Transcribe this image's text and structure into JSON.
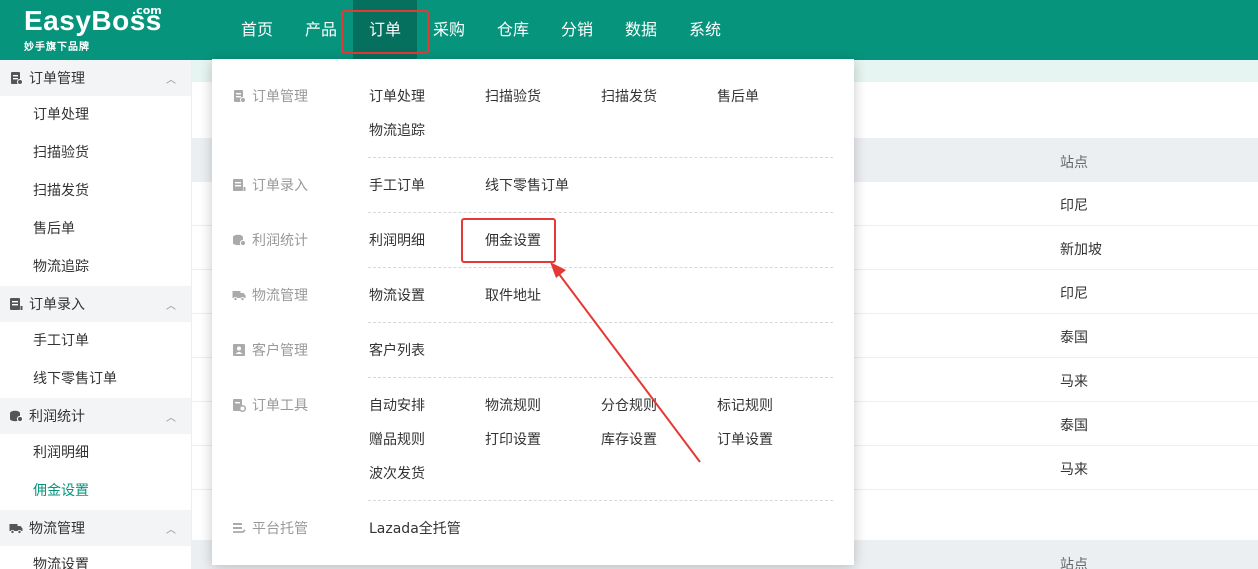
{
  "logo": {
    "main": "EasyBoss",
    "com": ".com",
    "sub": "妙手旗下品牌"
  },
  "nav": [
    "首页",
    "产品",
    "订单",
    "采购",
    "仓库",
    "分销",
    "数据",
    "系统"
  ],
  "sidebar": {
    "groups": [
      {
        "label": "订单管理",
        "icon": "order-manage-icon",
        "items": [
          "订单处理",
          "扫描验货",
          "扫描发货",
          "售后单",
          "物流追踪"
        ]
      },
      {
        "label": "订单录入",
        "icon": "order-entry-icon",
        "items": [
          "手工订单",
          "线下零售订单"
        ]
      },
      {
        "label": "利润统计",
        "icon": "profit-icon",
        "items": [
          "利润明细",
          "佣金设置"
        ]
      },
      {
        "label": "物流管理",
        "icon": "truck-icon",
        "items": [
          "物流设置"
        ]
      }
    ],
    "active_item": "佣金设置"
  },
  "table": {
    "site_header": "站点",
    "sites": [
      "印尼",
      "新加坡",
      "印尼",
      "泰国",
      "马来",
      "泰国",
      "马来"
    ]
  },
  "dropdown": {
    "sections": [
      {
        "title": "订单管理",
        "links": [
          "订单处理",
          "扫描验货",
          "扫描发货",
          "售后单",
          "物流追踪"
        ]
      },
      {
        "title": "订单录入",
        "links": [
          "手工订单",
          "线下零售订单"
        ]
      },
      {
        "title": "利润统计",
        "links": [
          "利润明细",
          "佣金设置"
        ]
      },
      {
        "title": "物流管理",
        "links": [
          "物流设置",
          "取件地址"
        ]
      },
      {
        "title": "客户管理",
        "links": [
          "客户列表"
        ]
      },
      {
        "title": "订单工具",
        "links": [
          "自动安排",
          "物流规则",
          "分仓规则",
          "标记规则",
          "赠品规则",
          "打印设置",
          "库存设置",
          "订单设置",
          "波次发货"
        ]
      },
      {
        "title": "平台托管",
        "links": [
          "Lazada全托管"
        ]
      }
    ]
  },
  "colors": {
    "brand": "#07947d",
    "highlight": "#e53935",
    "active_text": "#07947d"
  }
}
